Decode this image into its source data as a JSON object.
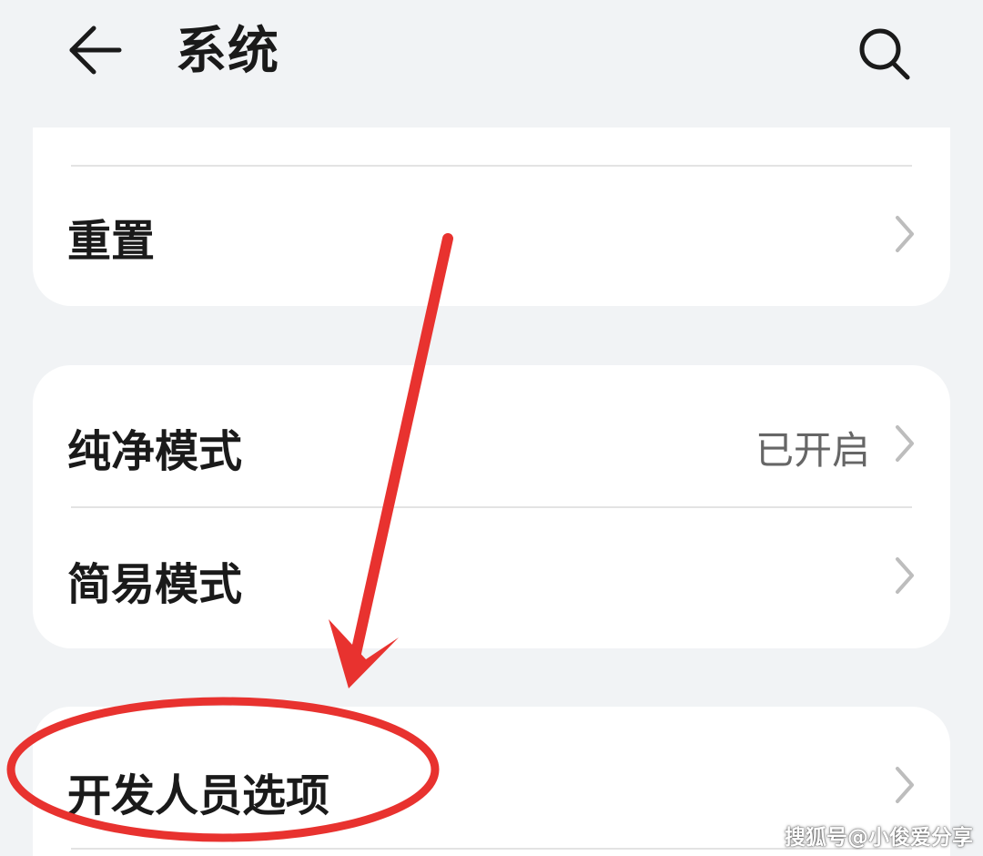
{
  "header": {
    "title": "系统",
    "back_icon": "arrow-left-icon",
    "search_icon": "search-icon"
  },
  "sections": [
    {
      "items": [
        {
          "label": "重置",
          "value": ""
        }
      ]
    },
    {
      "items": [
        {
          "label": "纯净模式",
          "value": "已开启"
        },
        {
          "label": "简易模式",
          "value": ""
        }
      ]
    },
    {
      "items": [
        {
          "label": "开发人员选项",
          "value": ""
        }
      ]
    }
  ],
  "annotation": {
    "color": "#e8322f",
    "highlighted_item": "开发人员选项"
  },
  "watermark": "搜狐号@小俊爱分享",
  "colors": {
    "background": "#f1f3f5",
    "card": "#ffffff",
    "secondary_text": "#666666",
    "chevron": "#bdbdbd"
  }
}
